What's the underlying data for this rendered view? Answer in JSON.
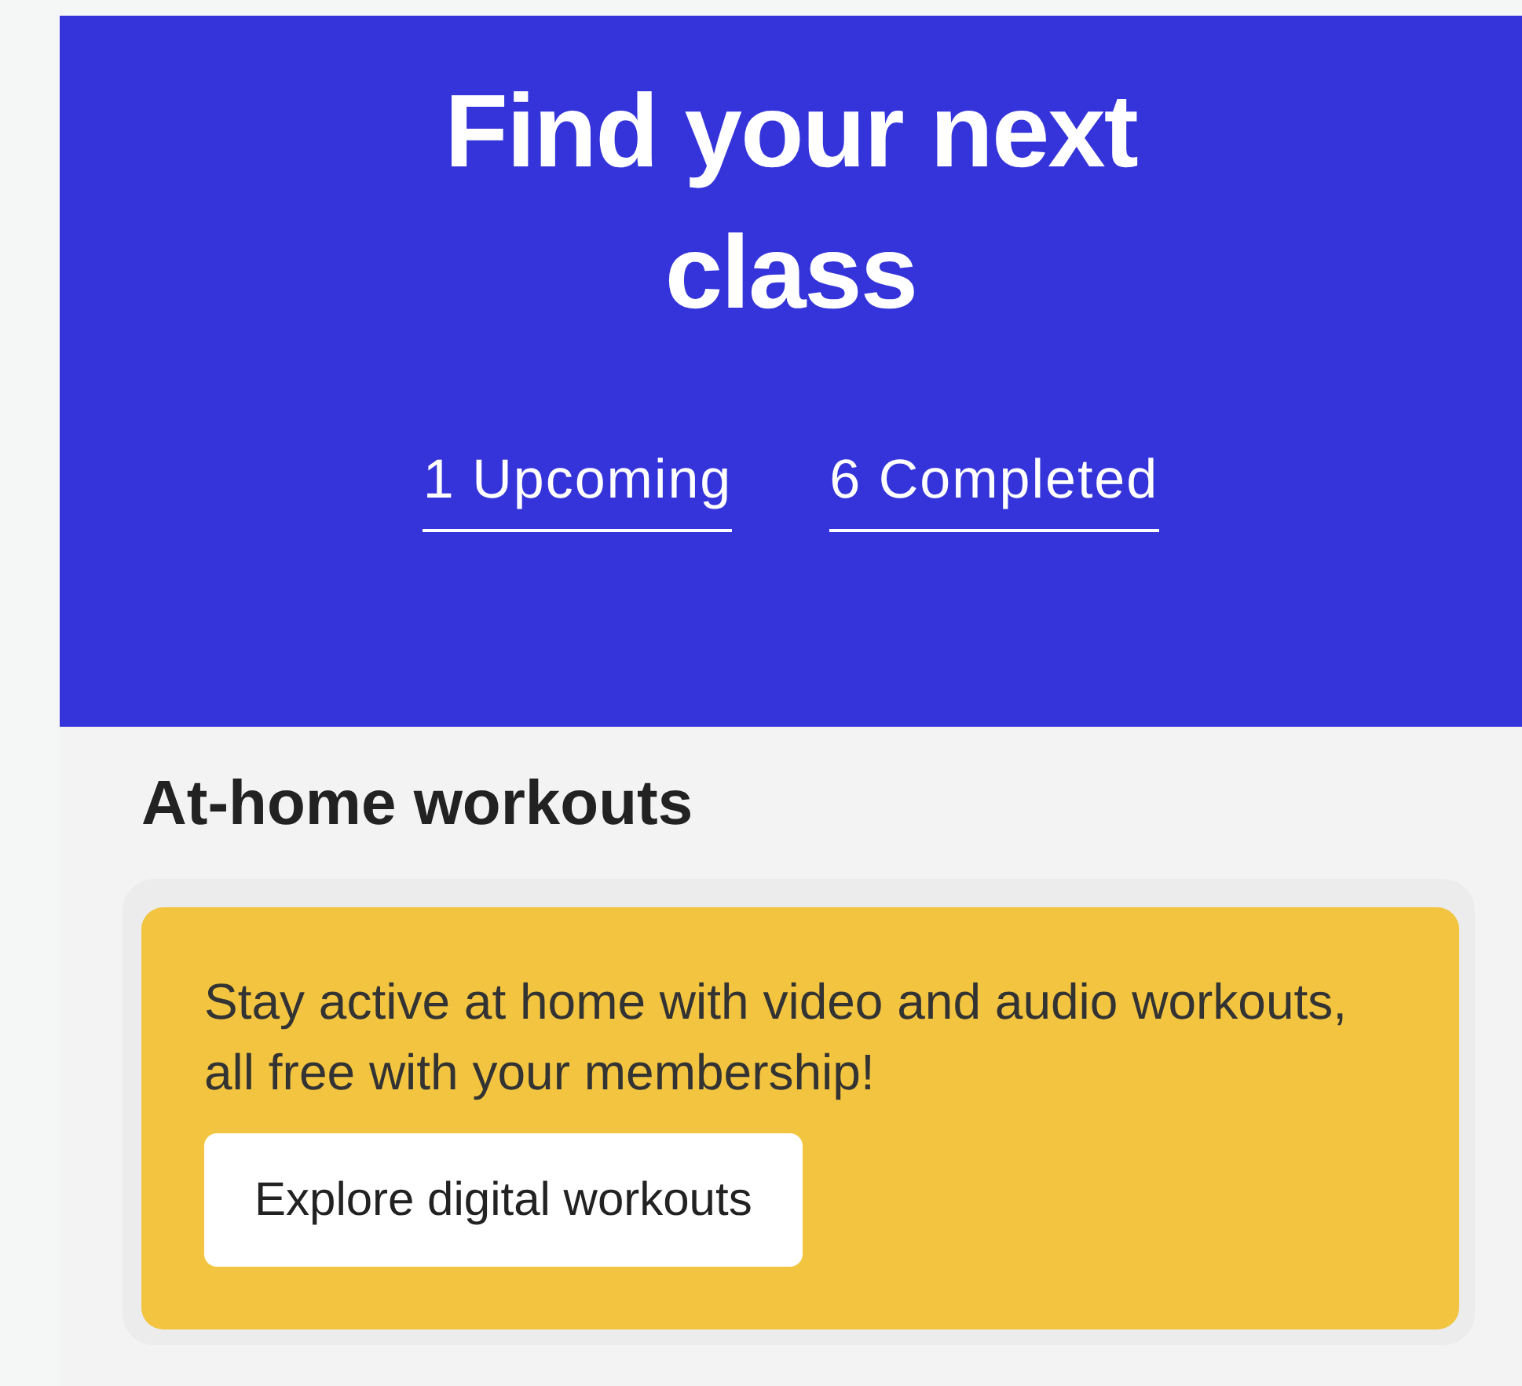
{
  "hero": {
    "title": "Find your next class",
    "links": [
      {
        "label": "1 Upcoming"
      },
      {
        "label": "6 Completed"
      }
    ]
  },
  "section": {
    "heading": "At-home workouts"
  },
  "promo": {
    "text": "Stay active at home with video and audio workouts, all free with your membership!",
    "button": "Explore digital workouts"
  }
}
